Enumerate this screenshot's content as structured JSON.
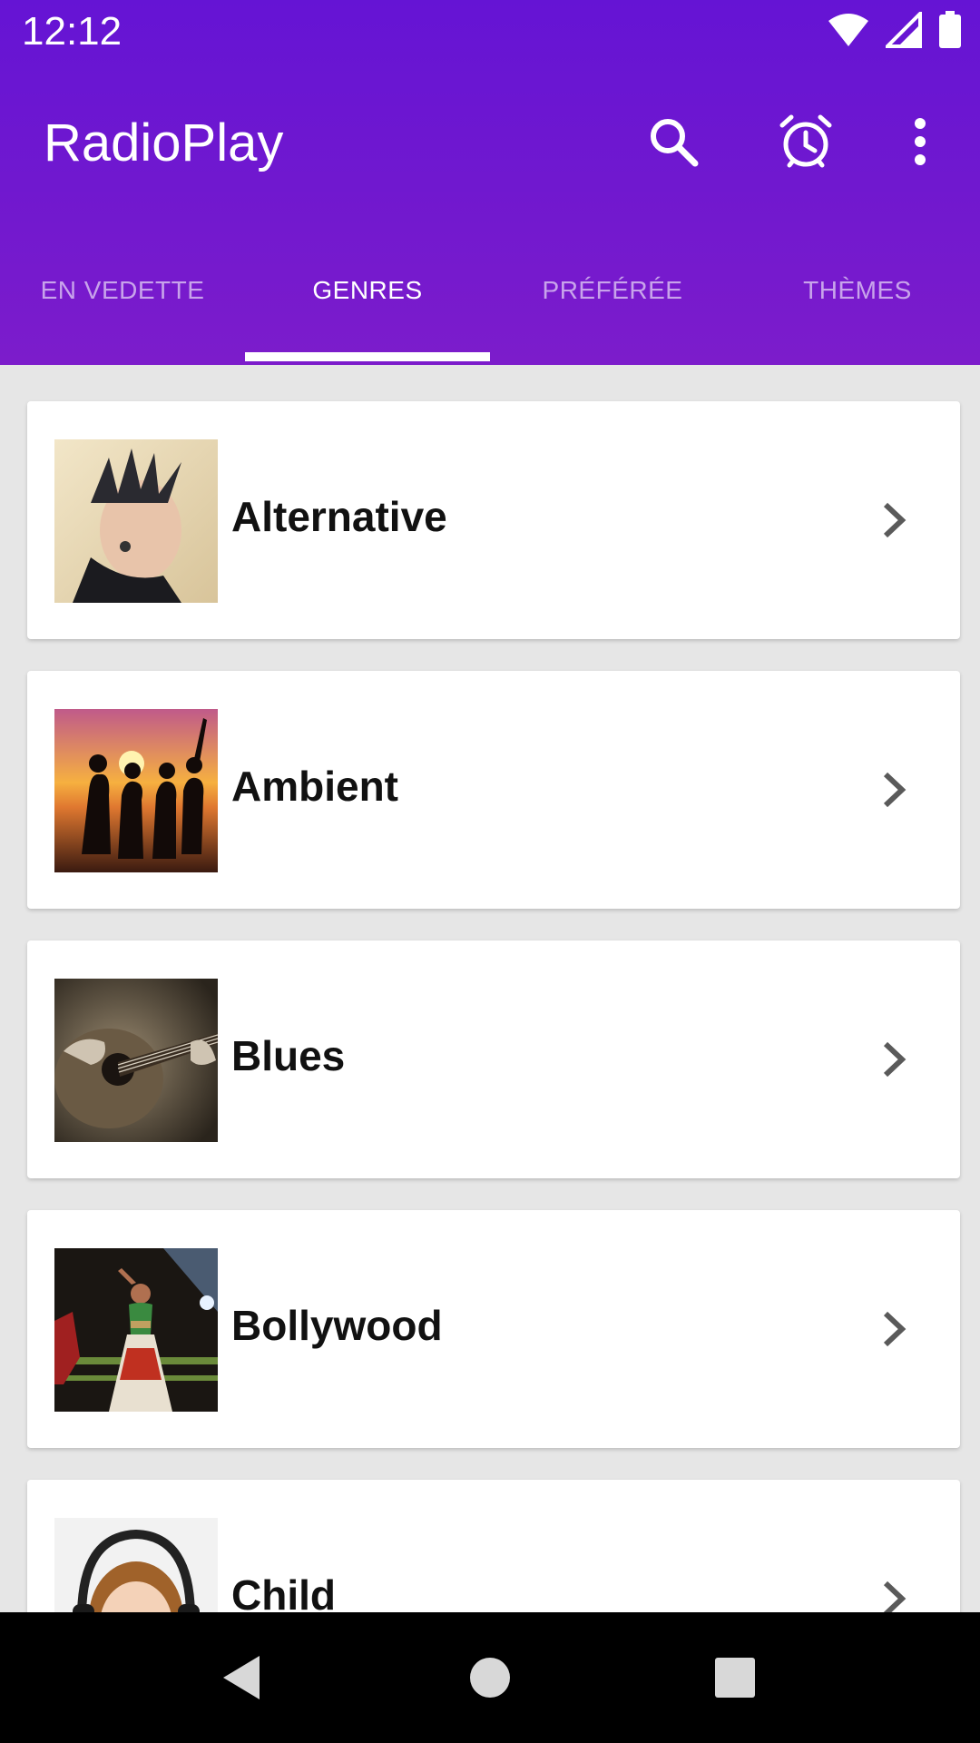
{
  "status_bar": {
    "time": "12:12",
    "icons": [
      "wifi-icon",
      "cell-signal-icon",
      "battery-icon"
    ]
  },
  "toolbar": {
    "title": "RadioPlay",
    "actions": [
      {
        "name": "search-icon"
      },
      {
        "name": "alarm-icon"
      },
      {
        "name": "more-vert-icon"
      }
    ]
  },
  "tabs": [
    {
      "label": "EN VEDETTE",
      "active": false
    },
    {
      "label": "GENRES",
      "active": true
    },
    {
      "label": "PRÉFÉRÉE",
      "active": false
    },
    {
      "label": "THÈMES",
      "active": false
    }
  ],
  "genres": [
    {
      "label": "Alternative",
      "icon": "chevron-right-icon"
    },
    {
      "label": "Ambient",
      "icon": "chevron-right-icon"
    },
    {
      "label": "Blues",
      "icon": "chevron-right-icon"
    },
    {
      "label": "Bollywood",
      "icon": "chevron-right-icon"
    },
    {
      "label": "Child",
      "icon": "chevron-right-icon"
    }
  ],
  "nav": {
    "icons": [
      "back-icon",
      "home-icon",
      "recents-icon"
    ]
  },
  "colors": {
    "primary": "#6a16d0",
    "background": "#e6e6e6",
    "card": "#ffffff",
    "navbar": "#000000"
  }
}
